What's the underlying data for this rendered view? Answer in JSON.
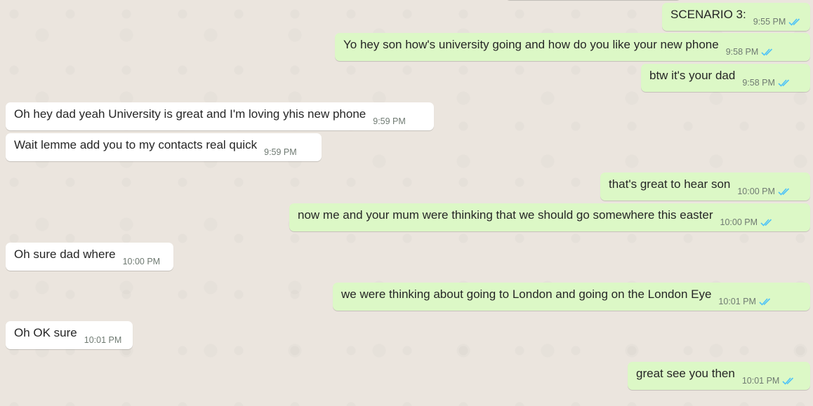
{
  "chat": {
    "messages": [
      {
        "direction": "out",
        "text": "SCENARIO 3:",
        "time": "9:55 PM",
        "status": "read"
      },
      {
        "direction": "out",
        "text": "Yo hey son how's university going and how do you like your new phone",
        "time": "9:58 PM",
        "status": "read"
      },
      {
        "direction": "out",
        "text": "btw it's your dad",
        "time": "9:58 PM",
        "status": "read"
      },
      {
        "direction": "in",
        "text": "Oh hey dad yeah University is great and I'm loving yhis new phone",
        "time": "9:59 PM"
      },
      {
        "direction": "in",
        "text": "Wait lemme add you to my contacts real quick",
        "time": "9:59 PM"
      },
      {
        "direction": "out",
        "text": "that's great to hear son",
        "time": "10:00 PM",
        "status": "read"
      },
      {
        "direction": "out",
        "text": "now me and your mum were thinking that we should go somewhere this easter",
        "time": "10:00 PM",
        "status": "read"
      },
      {
        "direction": "in",
        "text": "Oh sure dad where",
        "time": "10:00 PM"
      },
      {
        "direction": "out",
        "text": "we were thinking about going to London and going on the London Eye",
        "time": "10:01 PM",
        "status": "read"
      },
      {
        "direction": "in",
        "text": "Oh OK sure",
        "time": "10:01 PM"
      },
      {
        "direction": "out",
        "text": "great see you then",
        "time": "10:01 PM",
        "status": "read"
      }
    ]
  },
  "colors": {
    "outgoing_bubble": "#dcf8c6",
    "incoming_bubble": "#ffffff",
    "chat_background": "#ebe5de",
    "read_tick": "#4fc3f7"
  },
  "icons": {
    "read_receipt": "double-check-icon"
  }
}
